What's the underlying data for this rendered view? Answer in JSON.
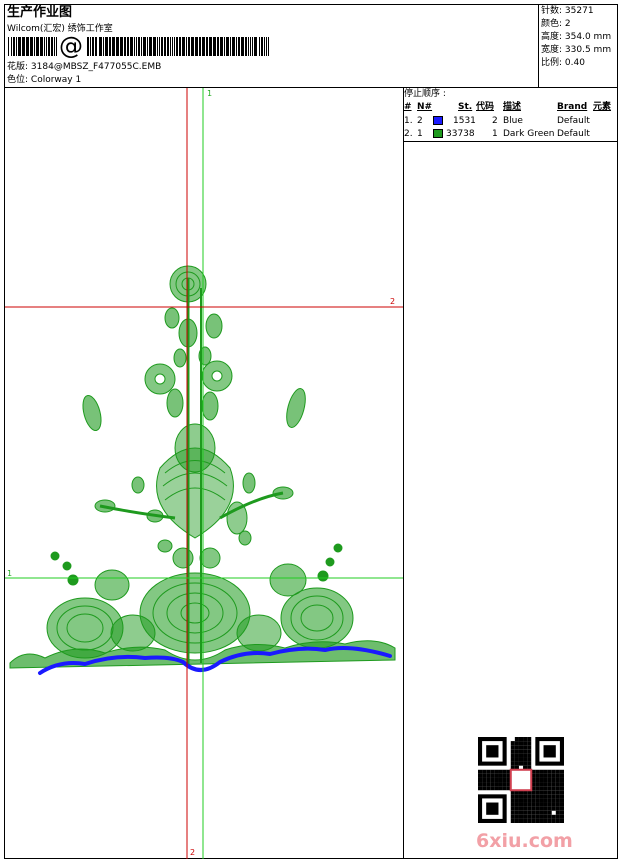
{
  "header": {
    "title": "生产作业图",
    "company": "Wilcom(汇宏) 绣饰工作室",
    "barcode_char": "@",
    "design_label": "花版:",
    "design_value": "3184@MBSZ_F477055C.EMB",
    "colorway_label": "色位:",
    "colorway_value": "Colorway 1"
  },
  "stats": [
    {
      "label": "针数:",
      "value": "35271"
    },
    {
      "label": "颜色:",
      "value": "2"
    },
    {
      "label": "高度:",
      "value": "354.0 mm"
    },
    {
      "label": "宽度:",
      "value": "330.5 mm"
    },
    {
      "label": "比例:",
      "value": "0.40"
    }
  ],
  "stop_sequence": {
    "title": "停止顺序 :",
    "columns": [
      "#",
      "N#",
      "St.",
      "代码",
      "描述",
      "Brand",
      "元素"
    ],
    "rows": [
      {
        "index": "1.",
        "n": "2",
        "color": "#1a1aff",
        "stitches": "1531",
        "code": "2",
        "desc": "Blue",
        "brand": "Default"
      },
      {
        "index": "2.",
        "n": "1",
        "color": "#1e9a1e",
        "stitches": "33738",
        "code": "1",
        "desc": "Dark Green",
        "brand": "Default"
      }
    ]
  },
  "guides": {
    "v1": "1",
    "v2": "2",
    "h1": "1",
    "h2": "2",
    "v2_bottom": "2"
  },
  "colors": {
    "green": "#1e9a1e",
    "blue": "#1a1aff",
    "guide_red": "#cc0000",
    "guide_green": "#22cc22"
  },
  "watermark": {
    "text": "6xiu.com"
  }
}
